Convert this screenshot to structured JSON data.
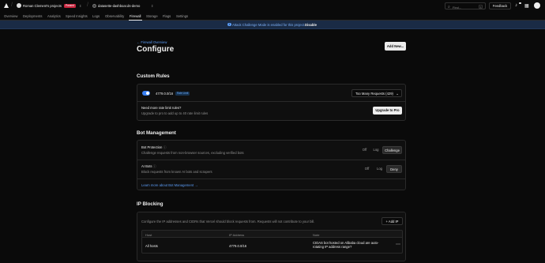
{
  "header": {
    "team_name": "Roman Clement's projects",
    "team_status": "Paused",
    "project_name": "datasette-dashboar.ds-demo",
    "search_placeholder": "Find...",
    "search_shortcut": "F",
    "feedback_label": "Feedback"
  },
  "tabs": [
    {
      "label": "Overview"
    },
    {
      "label": "Deployments"
    },
    {
      "label": "Analytics"
    },
    {
      "label": "Speed Insights"
    },
    {
      "label": "Logs"
    },
    {
      "label": "Observability"
    },
    {
      "label": "Firewall",
      "active": true
    },
    {
      "label": "Storage"
    },
    {
      "label": "Flags"
    },
    {
      "label": "Settings"
    }
  ],
  "banner": {
    "message": "Attack Challenge Mode is enabled for this project.",
    "action": "Disable"
  },
  "page": {
    "back_link": "Firewall Overview",
    "title": "Configure",
    "add_new_label": "Add New..."
  },
  "custom_rules": {
    "section_title": "Custom Rules",
    "rule_cidr": "4779.0.0/16",
    "rule_badge": "Rate Limit",
    "rule_action": "Too Many Requests (429)",
    "upsell_title": "Need more rate limit rules?",
    "upsell_desc": "Upgrade to pro to add up to 40 rate limit rules",
    "upgrade_label": "Upgrade to Pro"
  },
  "bot_management": {
    "section_title": "Bot Management",
    "bot_protection_title": "Bot Protection",
    "bot_protection_desc": "Challenge requests from non-browser sources, excluding verified bots",
    "bot_protection_options": [
      "Off",
      "Log",
      "Challenge"
    ],
    "bot_protection_selected": "Challenge",
    "ai_bots_title": "AI Bots",
    "ai_bots_desc": "Block requests from known AI bots and scrapers",
    "ai_bots_options": [
      "Off",
      "Log",
      "Deny"
    ],
    "ai_bots_selected": "Deny",
    "learn_more": "Learn more about Bot Management"
  },
  "ip_blocking": {
    "section_title": "IP Blocking",
    "description": "Configure the IP addresses and CIDRs that Vercel should block requests from. Requests will not contribute to your bill.",
    "add_ip_label": "Add IP",
    "columns": [
      "Host",
      "IP Address",
      "Note"
    ],
    "rows": [
      {
        "host": "All hosts",
        "ip": "4779.0.0/16",
        "note": "CIDAS bot hosted on Alibaba cloud are auto-rotating IP address range?"
      }
    ]
  },
  "colors": {
    "background": "#0a0a0a",
    "accent_blue": "#3b82f6",
    "link_blue": "#5b9cf5",
    "paused_red": "#c7253e",
    "banner_bg": "#1a2b45"
  }
}
